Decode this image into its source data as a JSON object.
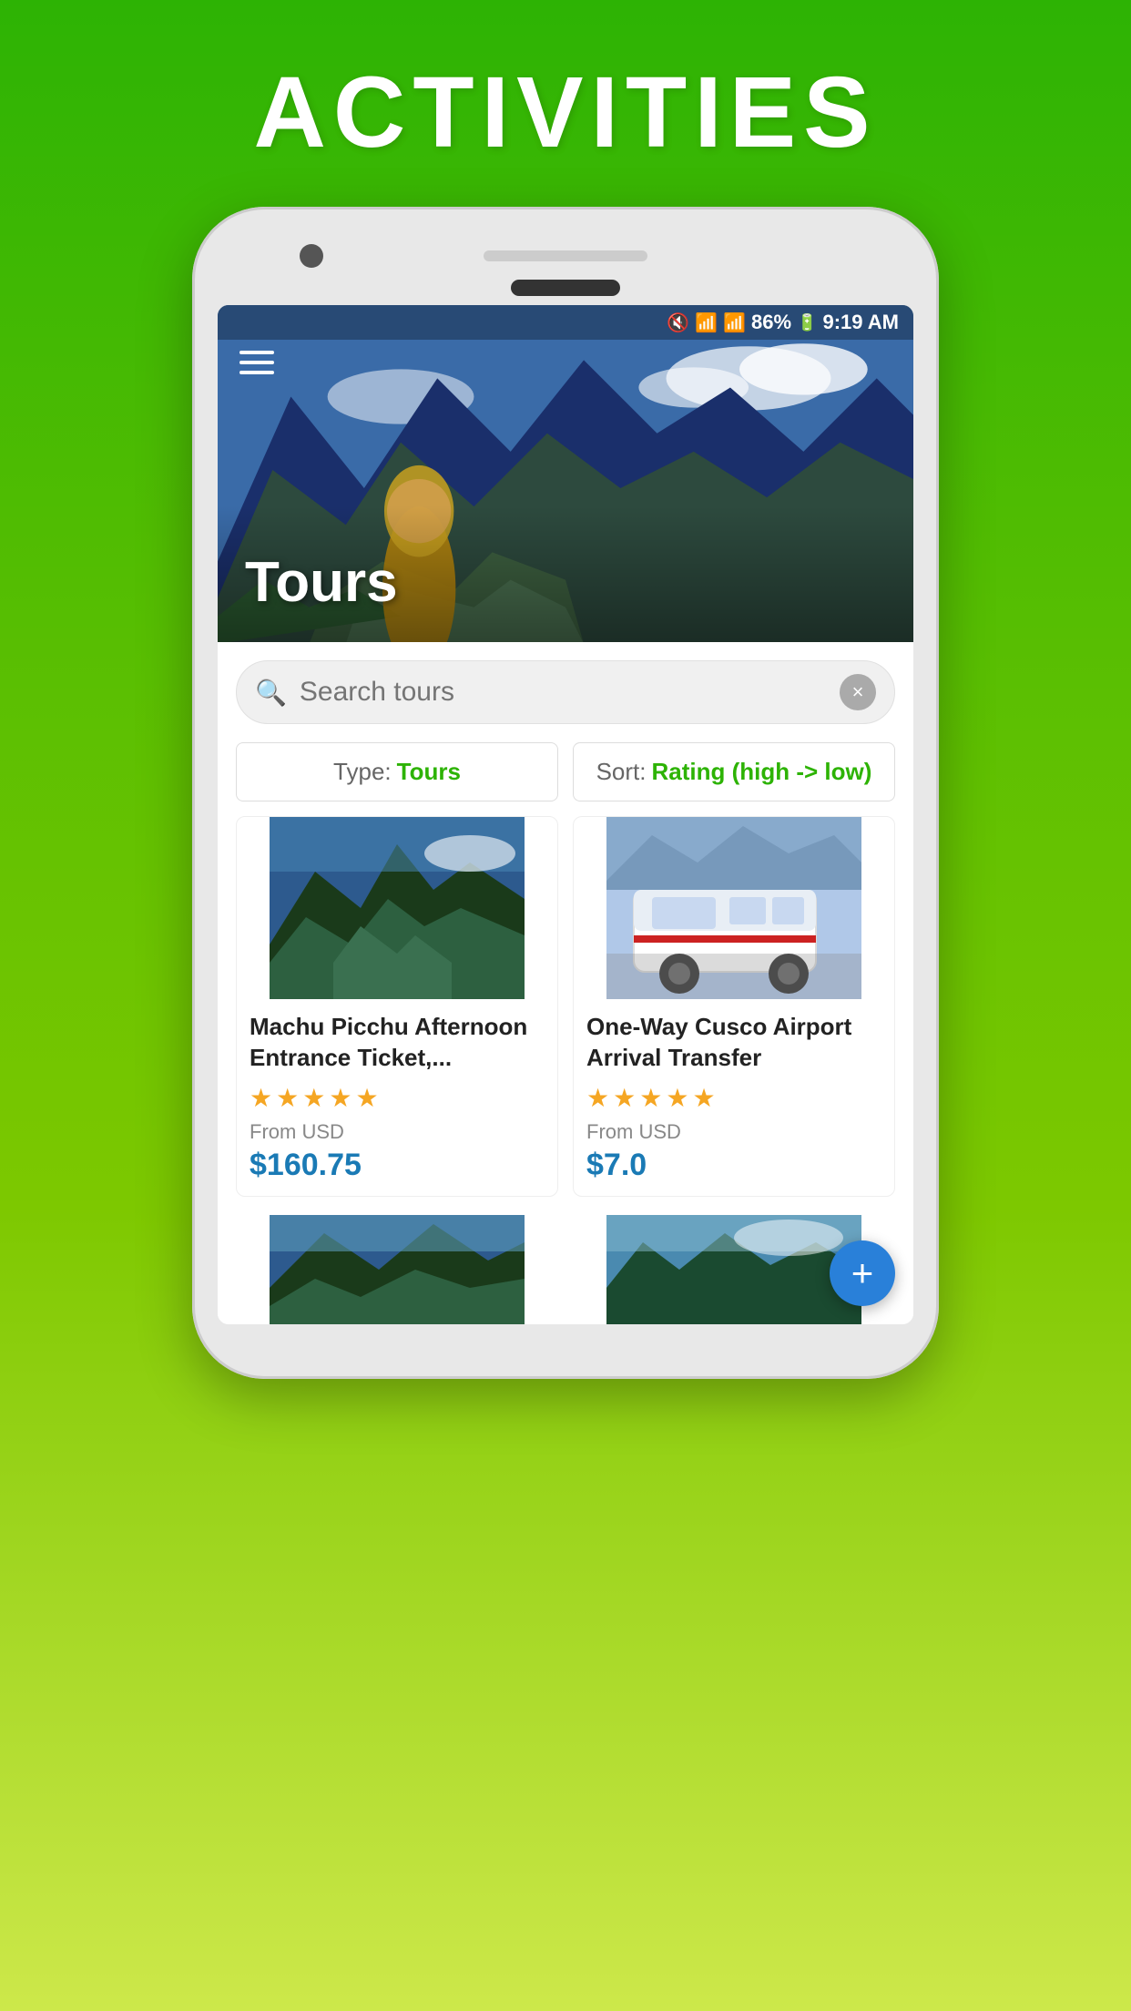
{
  "header": {
    "title": "ACTIVITIES"
  },
  "statusBar": {
    "time": "9:19 AM",
    "battery": "86%",
    "icons": "mute wifi signal battery"
  },
  "hero": {
    "title": "Tours",
    "hamburger_label": "menu"
  },
  "search": {
    "placeholder": "Search tours",
    "clear_label": "×"
  },
  "filters": {
    "type_label": "Type:",
    "type_value": "Tours",
    "sort_label": "Sort:",
    "sort_value": "Rating (high -> low)"
  },
  "tours": [
    {
      "title": "Machu Picchu Afternoon Entrance Ticket,...",
      "stars": 4.5,
      "from_label": "From USD",
      "price": "$160.75"
    },
    {
      "title": "One-Way Cusco Airport Arrival Transfer",
      "stars": 5,
      "from_label": "From USD",
      "price": "$7.0"
    }
  ],
  "fab": {
    "label": "+"
  }
}
